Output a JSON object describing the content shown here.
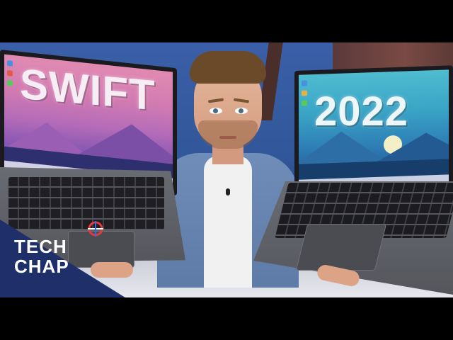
{
  "headline_left": "SWIFT",
  "headline_right": "2022",
  "logo": {
    "line1": "TECH",
    "line2": "CHAP"
  },
  "colors": {
    "left_screen": "#d27bb2",
    "right_screen": "#3aa4c6",
    "logo_band": "#1e2f6a",
    "background_wall": "#31579a"
  }
}
